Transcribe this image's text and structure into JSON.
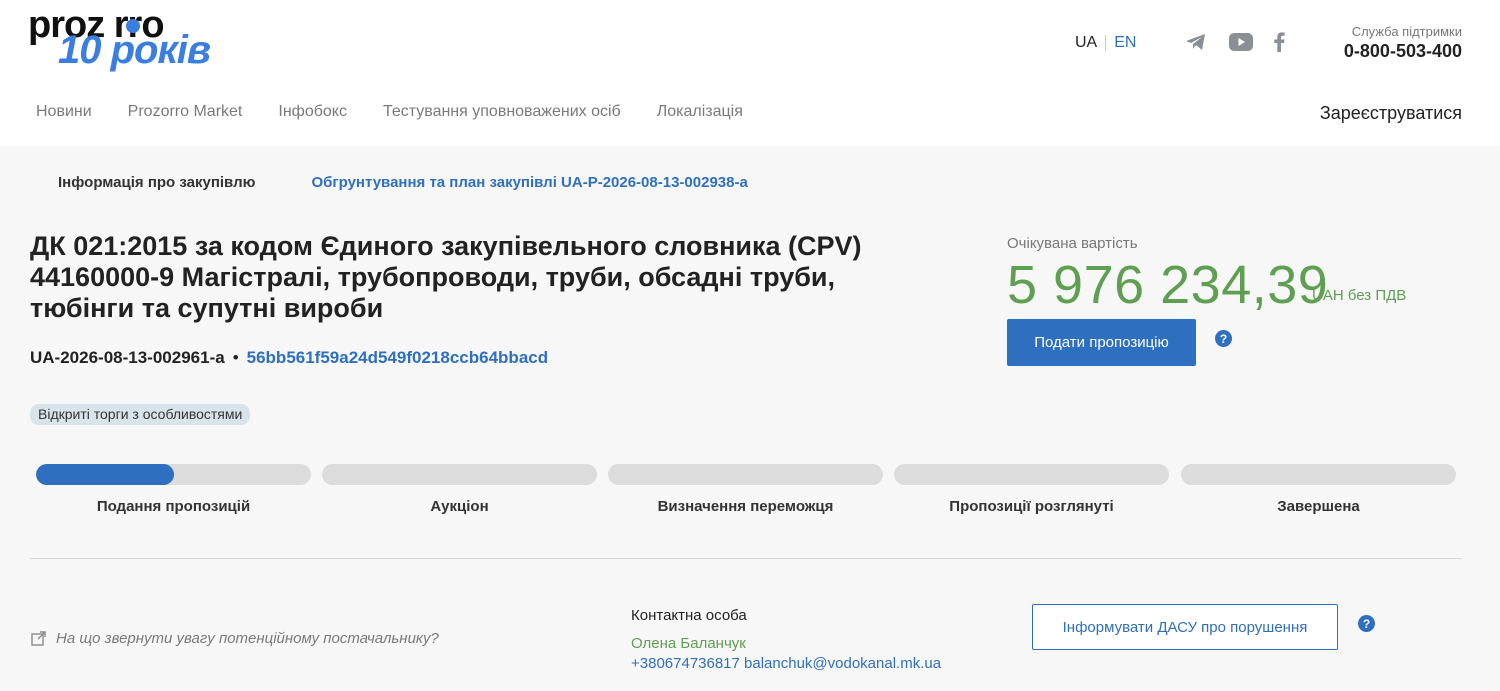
{
  "header": {
    "logo_top": "proz rro",
    "logo_bottom": "10 років",
    "lang_ua": "UA",
    "lang_en": "EN",
    "support_label": "Служба підтримки",
    "support_phone": "0-800-503-400",
    "register_label": "Зареєструватися",
    "social_icons": [
      "telegram-icon",
      "youtube-icon",
      "facebook-icon"
    ]
  },
  "nav": {
    "items": [
      "Новини",
      "Prozorro Market",
      "Інфобокс",
      "Тестування уповноважених осіб",
      "Локалізація"
    ]
  },
  "tabs": {
    "info": "Інформація про закупівлю",
    "plan": "Обгрунтування та план закупівлі UA-P-2026-08-13-002938-a"
  },
  "tender": {
    "title": "ДК 021:2015 за кодом Єдиного закупівельного словника (CPV) 44160000-9 Магістралі, трубопроводи, труби, обсадні труби, тюбінги та супутні вироби",
    "id": "UA-2026-08-13-002961-a",
    "bullet": "•",
    "hash": "56bb561f59a24d549f0218ccb64bbacd",
    "procedure_badge": "Відкриті торги з особливостями",
    "price_label": "Очікувана вартість",
    "price_value": "5 976 234,39",
    "price_unit": "UAH без ПДВ",
    "submit_label": "Подати пропозицію",
    "help_glyph": "?"
  },
  "stages": [
    {
      "label": "Подання пропозицій",
      "progress": 0.5
    },
    {
      "label": "Аукціон",
      "progress": 0
    },
    {
      "label": "Визначення переможця",
      "progress": 0
    },
    {
      "label": "Пропозиції розглянуті",
      "progress": 0
    },
    {
      "label": "Завершена",
      "progress": 0
    }
  ],
  "footer": {
    "hint": "На що звернути увагу потенційному постачальнику?",
    "contact_label": "Контактна особа",
    "contact_name": "Олена Баланчук",
    "contact_info": "+380674736817 balanchuk@vodokanal.mk.ua",
    "dasu_label": "Інформувати ДАСУ про порушення"
  },
  "colors": {
    "accent": "#2f6fc0",
    "price_green": "#5f9f52",
    "bar_empty": "#dcdcdc"
  }
}
